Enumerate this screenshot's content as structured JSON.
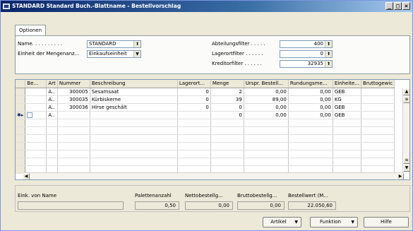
{
  "window": {
    "title": "STANDARD Standard Buch.-Blattname - Bestellvorschlag",
    "buttons": [
      "_",
      "□",
      "×"
    ]
  },
  "tabs": [
    {
      "label": "Optionen",
      "active": true
    }
  ],
  "options": {
    "name_label": "Name. . . . . . . . . .",
    "name_value": "STANDARD",
    "unit_label": "Einheit der Mengenanz...",
    "unit_value": "Einkaufseinheit",
    "dept_filter_label": "Abteilungsfilter . . . . .",
    "dept_filter_value": "400",
    "storage_filter_label": "Lagerortfilter . . . . . .",
    "storage_filter_value": "0",
    "vendor_filter_label": "Kreditorfilter . . . . . .",
    "vendor_filter_value": "32935"
  },
  "grid": {
    "columns": [
      "Be...",
      "Art",
      "Nummer",
      "Beschreibung",
      "Lagerort...",
      "Menge",
      "Urspr. Bestell...",
      "Rundungsme...",
      "Einheite...",
      "Bruttogewic"
    ],
    "rows": [
      [
        "",
        "A..",
        "300005",
        "Sesamsaat",
        "0",
        "2",
        "0,00",
        "0,00",
        "GEB",
        ""
      ],
      [
        "",
        "A..",
        "300035",
        "Kürbiskerne",
        "0",
        "39",
        "89,00",
        "0,00",
        "KG",
        ""
      ],
      [
        "",
        "A..",
        "300036",
        "Hirse geschält",
        "0",
        "0",
        "0,00",
        "0,00",
        "GEB",
        ""
      ],
      [
        "",
        "A..",
        "",
        "",
        "",
        "0",
        "0,00",
        "0,00",
        "GEB",
        ""
      ]
    ],
    "current_row_marker": "✱▸"
  },
  "summary": {
    "vendor_name_label": "Eink. von Name",
    "vendor_name_value": "",
    "pallet_label": "Palettenanzahl",
    "pallet_value": "0,50",
    "net_order_label": "Nettobestellg...",
    "net_order_value": "0,00",
    "gross_order_label": "Bruttobestellg...",
    "gross_order_value": "0,00",
    "order_value_label": "Bestellwert (M...",
    "order_value_value": "22.050,60"
  },
  "actions": {
    "artikel_label": "Artikel",
    "funktion_label": "Funktion",
    "hilfe_label": "Hilfe"
  },
  "colors": {
    "titlebar_start": "#0a246a",
    "titlebar_end": "#a6caf0",
    "face": "#ece9d8"
  }
}
